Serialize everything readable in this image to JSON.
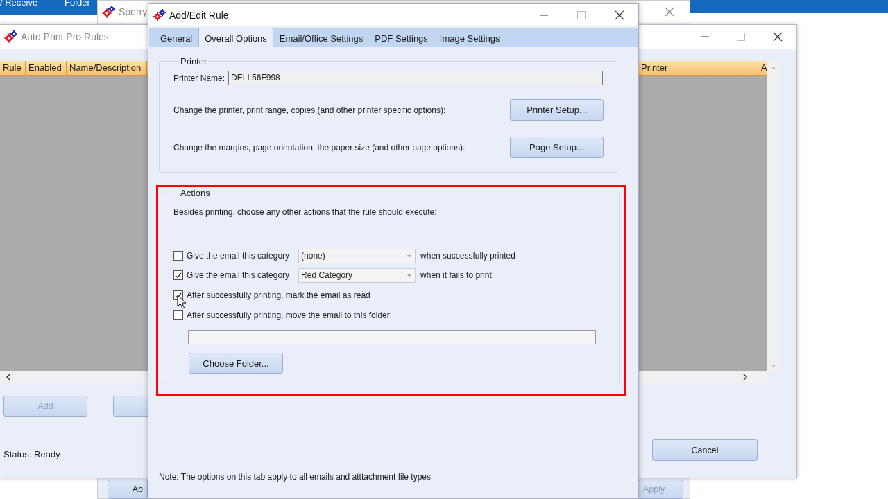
{
  "outlook": {
    "ribbon_items": [
      "/ Receive",
      "Folder"
    ]
  },
  "sperry_window": {
    "title": "Sperry",
    "buttons": [
      {
        "label": "Ab",
        "disabled": false
      },
      {
        "label": "Apply",
        "disabled": true
      }
    ]
  },
  "rules_window": {
    "title": "Auto Print Pro Rules",
    "columns": [
      "Rule",
      "Enabled",
      "Name/Description",
      "Printer",
      "A"
    ],
    "buttons": [
      {
        "label": "Add",
        "disabled": true
      }
    ],
    "status": "Status: Ready",
    "cancel_button": "Cancel"
  },
  "dialog": {
    "title": "Add/Edit Rule",
    "tabs": [
      {
        "label": "General",
        "selected": false
      },
      {
        "label": "Overall Options",
        "selected": true
      },
      {
        "label": "Email/Office Settings",
        "selected": false
      },
      {
        "label": "PDF Settings",
        "selected": false
      },
      {
        "label": "Image Settings",
        "selected": false
      }
    ],
    "printer_group": {
      "title": "Printer",
      "name_label": "Printer Name:",
      "name_value": "DELL56F998",
      "rows": [
        {
          "text": "Change the printer, print range, copies (and other printer specific options):",
          "button": "Printer Setup..."
        },
        {
          "text": "Change the margins, page orientation, the paper size (and other page options):",
          "button": "Page Setup..."
        }
      ]
    },
    "actions_group": {
      "title": "Actions",
      "highlighted": true,
      "intro": "Besides printing, choose any other actions that the rule should execute:",
      "options": [
        {
          "kind": "category",
          "checked": false,
          "label": "Give the email this category",
          "value": "(none)",
          "suffix": "when successfully printed"
        },
        {
          "kind": "category",
          "checked": true,
          "label": "Give the email this category",
          "value": "Red Category",
          "suffix": "when it fails to print"
        },
        {
          "kind": "check",
          "checked": true,
          "label": "After successfully printing, mark the email as read"
        },
        {
          "kind": "folder",
          "checked": false,
          "label": "After successfully printing, move the email to this folder:",
          "button": "Choose Folder..."
        }
      ]
    },
    "note": "Note: The options on this tab apply to all emails and atttachment file types"
  }
}
